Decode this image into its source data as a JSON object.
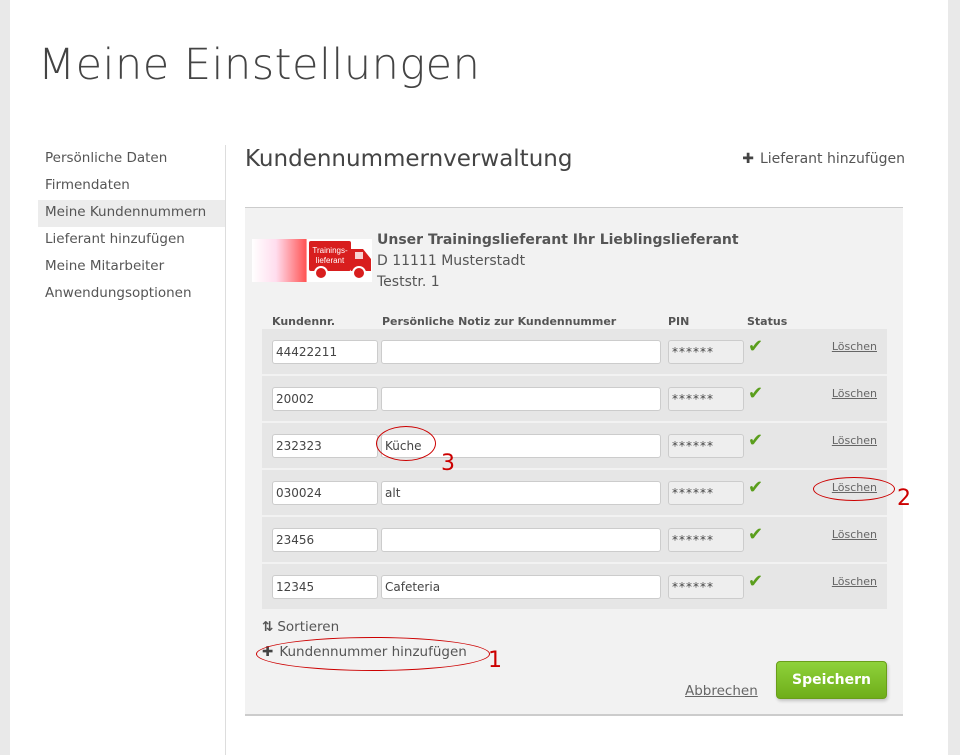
{
  "page_title": "Meine Einstellungen",
  "sidebar": {
    "items": [
      {
        "label": "Persönliche Daten"
      },
      {
        "label": "Firmendaten"
      },
      {
        "label": "Meine Kundennummern"
      },
      {
        "label": "Lieferant hinzufügen"
      },
      {
        "label": "Meine Mitarbeiter"
      },
      {
        "label": "Anwendungsoptionen"
      }
    ]
  },
  "section": {
    "title": "Kundennummernverwaltung",
    "add_supplier": "Lieferant hinzufügen"
  },
  "supplier": {
    "logo_text": "Trainings-lieferant",
    "name": "Unser Trainingslieferant Ihr Lieblingslieferant",
    "city": "D 11111 Musterstadt",
    "street": "Teststr. 1"
  },
  "columns": {
    "number": "Kundennr.",
    "note": "Persönliche Notiz zur Kundennummer",
    "pin": "PIN",
    "status": "Status"
  },
  "rows": [
    {
      "number": "44422211",
      "note": "",
      "pin": "******",
      "delete": "Löschen"
    },
    {
      "number": "20002",
      "note": "",
      "pin": "******",
      "delete": "Löschen"
    },
    {
      "number": "232323",
      "note": "Küche",
      "pin": "******",
      "delete": "Löschen"
    },
    {
      "number": "030024",
      "note": "alt",
      "pin": "******",
      "delete": "Löschen"
    },
    {
      "number": "23456",
      "note": "",
      "pin": "******",
      "delete": "Löschen"
    },
    {
      "number": "12345",
      "note": "Cafeteria",
      "pin": "******",
      "delete": "Löschen"
    }
  ],
  "actions": {
    "sort": "Sortieren",
    "add_number": "Kundennummer hinzufügen",
    "cancel": "Abbrechen",
    "save": "Speichern"
  },
  "annotations": [
    "1",
    "2",
    "3"
  ]
}
